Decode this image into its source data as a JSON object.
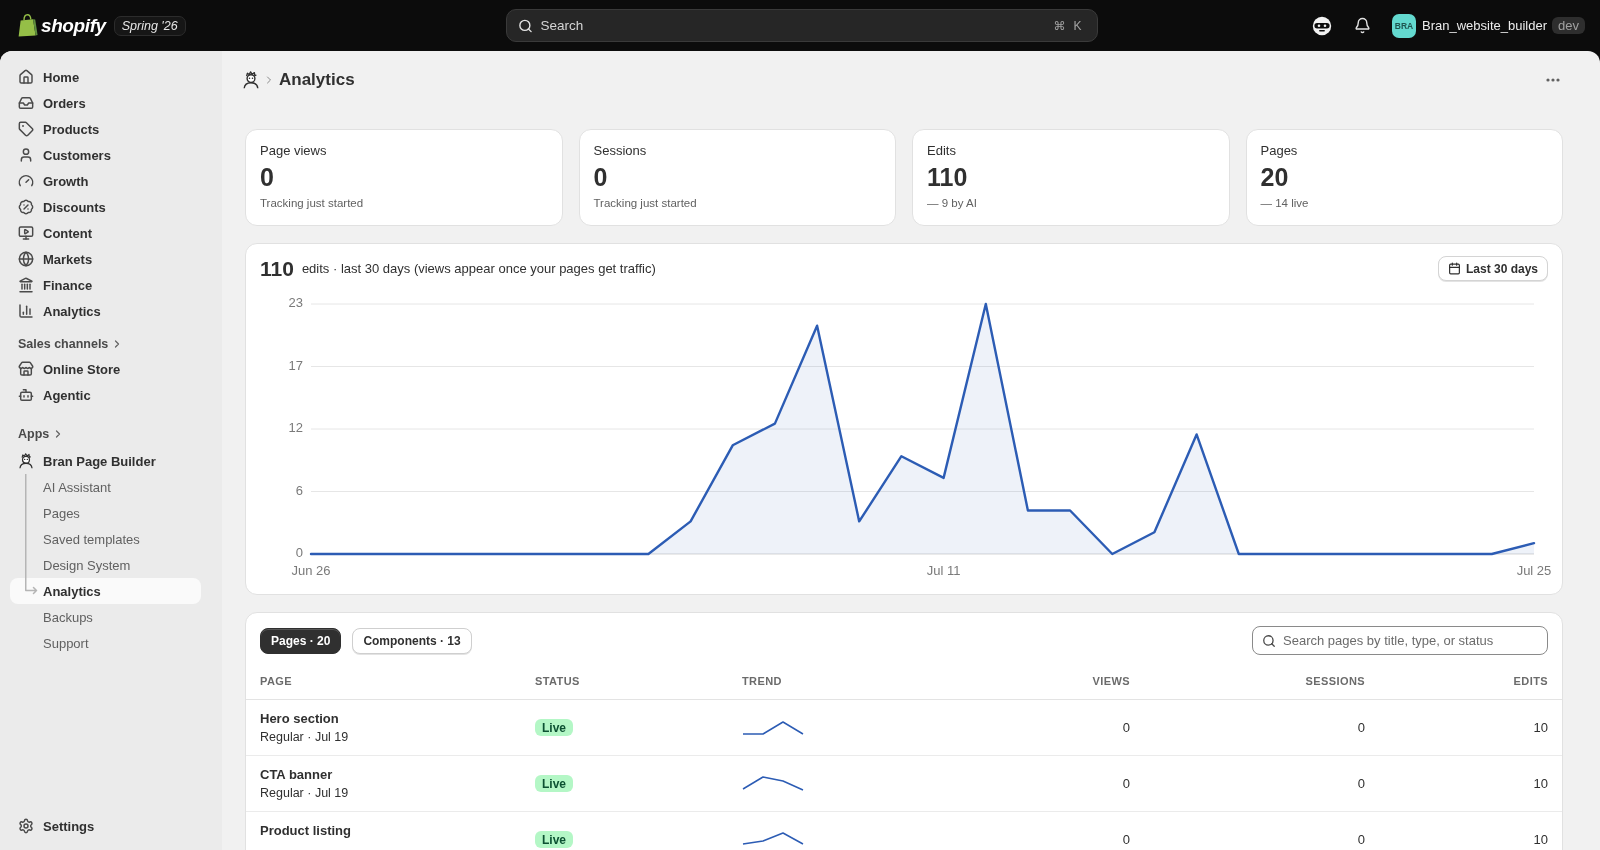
{
  "topbar": {
    "brand": "shopify",
    "edition": "Spring '26",
    "search": {
      "placeholder": "Search",
      "keys": [
        "⌘",
        "K"
      ]
    },
    "account": {
      "initials": "BRA",
      "name": "Bran_website_builder",
      "badge": "dev"
    }
  },
  "sidebar": {
    "items": [
      {
        "label": "Home",
        "selected": false
      },
      {
        "label": "Orders",
        "selected": false
      },
      {
        "label": "Products",
        "selected": false
      },
      {
        "label": "Customers",
        "selected": false
      },
      {
        "label": "Growth",
        "selected": false
      },
      {
        "label": "Discounts",
        "selected": false
      },
      {
        "label": "Content",
        "selected": false
      },
      {
        "label": "Markets",
        "selected": false
      },
      {
        "label": "Finance",
        "selected": false
      },
      {
        "label": "Analytics",
        "selected": false
      }
    ],
    "sales_channels": {
      "title": "Sales channels",
      "items": [
        {
          "label": "Online Store",
          "selected": false
        },
        {
          "label": "Agentic",
          "selected": false
        }
      ]
    },
    "apps": {
      "title": "Apps",
      "items": [
        {
          "label": "Bran Page Builder",
          "selected": false,
          "children": [
            {
              "label": "AI Assistant",
              "selected": false
            },
            {
              "label": "Pages",
              "selected": false
            },
            {
              "label": "Saved templates",
              "selected": false
            },
            {
              "label": "Design System",
              "selected": false
            },
            {
              "label": "Analytics",
              "selected": true
            },
            {
              "label": "Backups",
              "selected": false
            },
            {
              "label": "Support",
              "selected": false
            }
          ]
        }
      ]
    },
    "settings": {
      "label": "Settings",
      "selected": false
    }
  },
  "page": {
    "title": "Analytics"
  },
  "stats": [
    {
      "label": "Page views",
      "value": "0",
      "note": "Tracking just started"
    },
    {
      "label": "Sessions",
      "value": "0",
      "note": "Tracking just started"
    },
    {
      "label": "Edits",
      "value": "110",
      "note": "— 9 by AI"
    },
    {
      "label": "Pages",
      "value": "20",
      "note": "— 14 live"
    }
  ],
  "activity": {
    "total": "110",
    "caption": "edits · last 30 days (views appear once your pages get traffic)",
    "range_button": "Last 30 days",
    "chart_data": {
      "type": "area",
      "grid": true,
      "categories": [
        "Jun 26",
        null,
        null,
        null,
        null,
        null,
        null,
        null,
        null,
        null,
        null,
        null,
        null,
        null,
        null,
        "Jul 11",
        null,
        null,
        null,
        null,
        null,
        null,
        null,
        null,
        null,
        null,
        null,
        null,
        null,
        "Jul 25"
      ],
      "ylim": [
        0,
        23
      ],
      "yticks": [
        0,
        {
          "value": 5.75,
          "label": "6"
        },
        {
          "value": 11.5,
          "label": "12"
        },
        {
          "value": 17.25,
          "label": "17"
        },
        23
      ],
      "series": [
        {
          "color": "#2c5cb4",
          "values": [
            0,
            0,
            0,
            0,
            0,
            0,
            0,
            0,
            0,
            3,
            10,
            12,
            21,
            3,
            9,
            7,
            23,
            4,
            4,
            0,
            2,
            11,
            0,
            0,
            0,
            0,
            0,
            0,
            0,
            1
          ]
        }
      ]
    }
  },
  "table": {
    "tabs": [
      {
        "label": "Pages · 20",
        "selected": true
      },
      {
        "label": "Components · 13",
        "selected": false
      }
    ],
    "search": {
      "placeholder": "Search pages by title, type, or status"
    },
    "columns": [
      "PAGE",
      "STATUS",
      "TREND",
      "VIEWS",
      "SESSIONS",
      "EDITS"
    ],
    "rows": [
      {
        "title": "Hero section",
        "subtitle": "Regular · Jul 19",
        "status": "Live",
        "views": "0",
        "sessions": "0",
        "edits": "10"
      },
      {
        "title": "CTA banner",
        "subtitle": "Regular · Jul 19",
        "status": "Live",
        "views": "0",
        "sessions": "0",
        "edits": "10"
      },
      {
        "title": "Product listing",
        "status": "Live",
        "views": "0",
        "sessions": "0",
        "edits": "10"
      }
    ]
  }
}
